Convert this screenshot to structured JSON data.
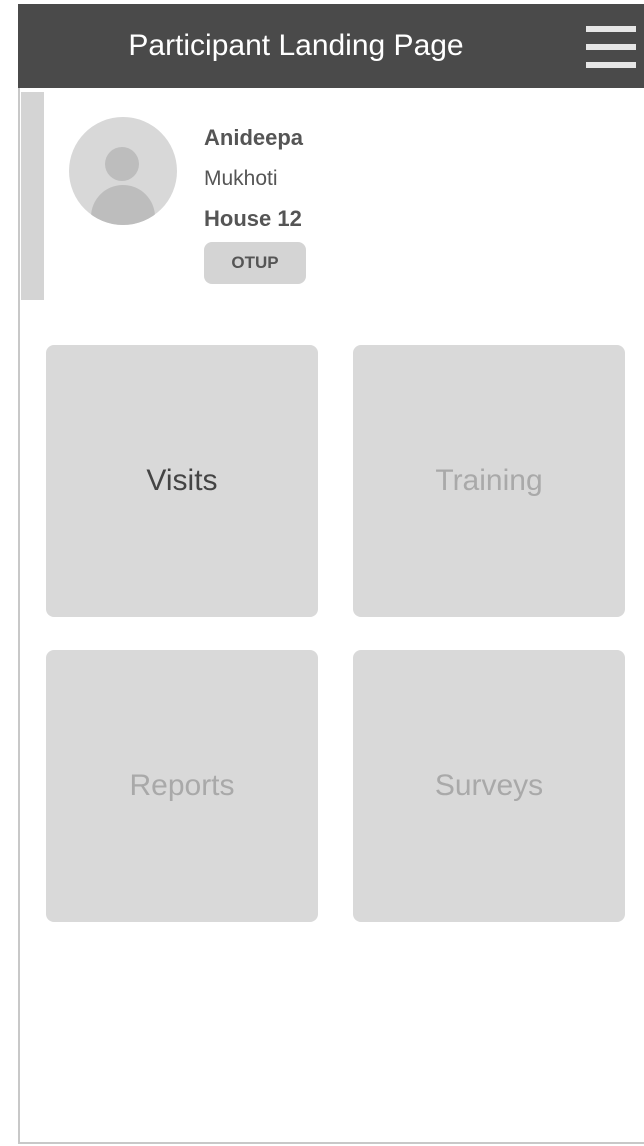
{
  "header": {
    "title": "Participant Landing Page",
    "menu_icon": "hamburger-menu-icon"
  },
  "profile": {
    "avatar_icon": "user-avatar-icon",
    "first_name": "Anideepa",
    "last_name": "Mukhoti",
    "house": "House 12",
    "badge": "OTUP"
  },
  "tiles": [
    {
      "label": "Visits",
      "state": "active"
    },
    {
      "label": "Training",
      "state": "muted"
    },
    {
      "label": "Reports",
      "state": "muted"
    },
    {
      "label": "Surveys",
      "state": "muted"
    }
  ],
  "colors": {
    "header_bg": "#4a4a4a",
    "tile_bg": "#d9d9d9",
    "text_dark": "#555555",
    "text_muted": "#a9a9a9"
  }
}
